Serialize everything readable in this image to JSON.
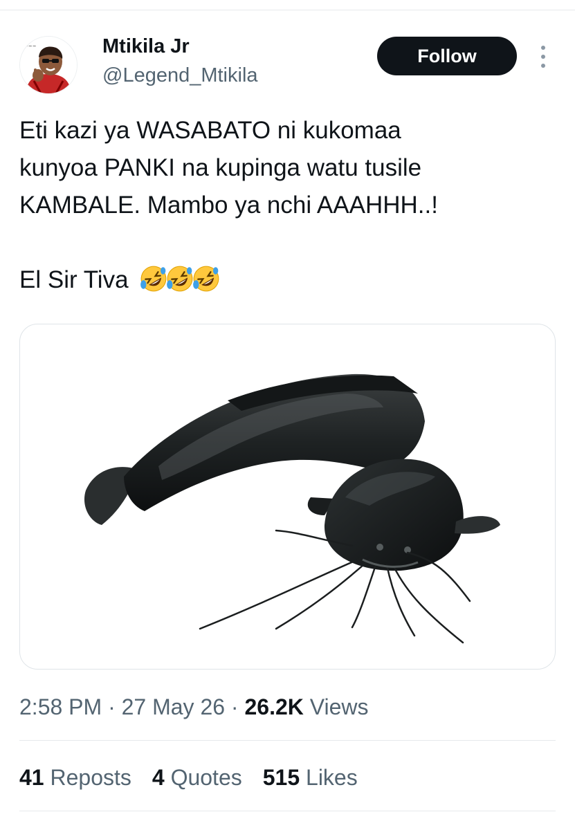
{
  "author": {
    "display_name": "Mtikila Jr",
    "handle": "@Legend_Mtikila"
  },
  "header": {
    "follow_label": "Follow",
    "more_icon": "more-vertical-icon"
  },
  "tweet": {
    "lines": [
      "Eti kazi ya WASABATO ni kukomaa",
      "kunyoa PANKI na kupinga watu tusile",
      "KAMBALE. Mambo ya nchi AAAHHH..!"
    ],
    "signoff": "El Sir Tiva",
    "emoji": "rolling-on-floor-laughing-emoji",
    "emoji_count": 3
  },
  "media": {
    "icon": "catfish-photo"
  },
  "meta": {
    "time": "2:58 PM",
    "separator": "·",
    "date": "27 May 26",
    "views_count": "26.2K",
    "views_label": "Views"
  },
  "stats": {
    "reposts_count": "41",
    "reposts_label": "Reposts",
    "quotes_count": "4",
    "quotes_label": "Quotes",
    "likes_count": "515",
    "likes_label": "Likes"
  },
  "colors": {
    "text": "#0f1419",
    "secondary": "#536471",
    "divider": "#e6e9ec",
    "button": "#0f1419"
  }
}
